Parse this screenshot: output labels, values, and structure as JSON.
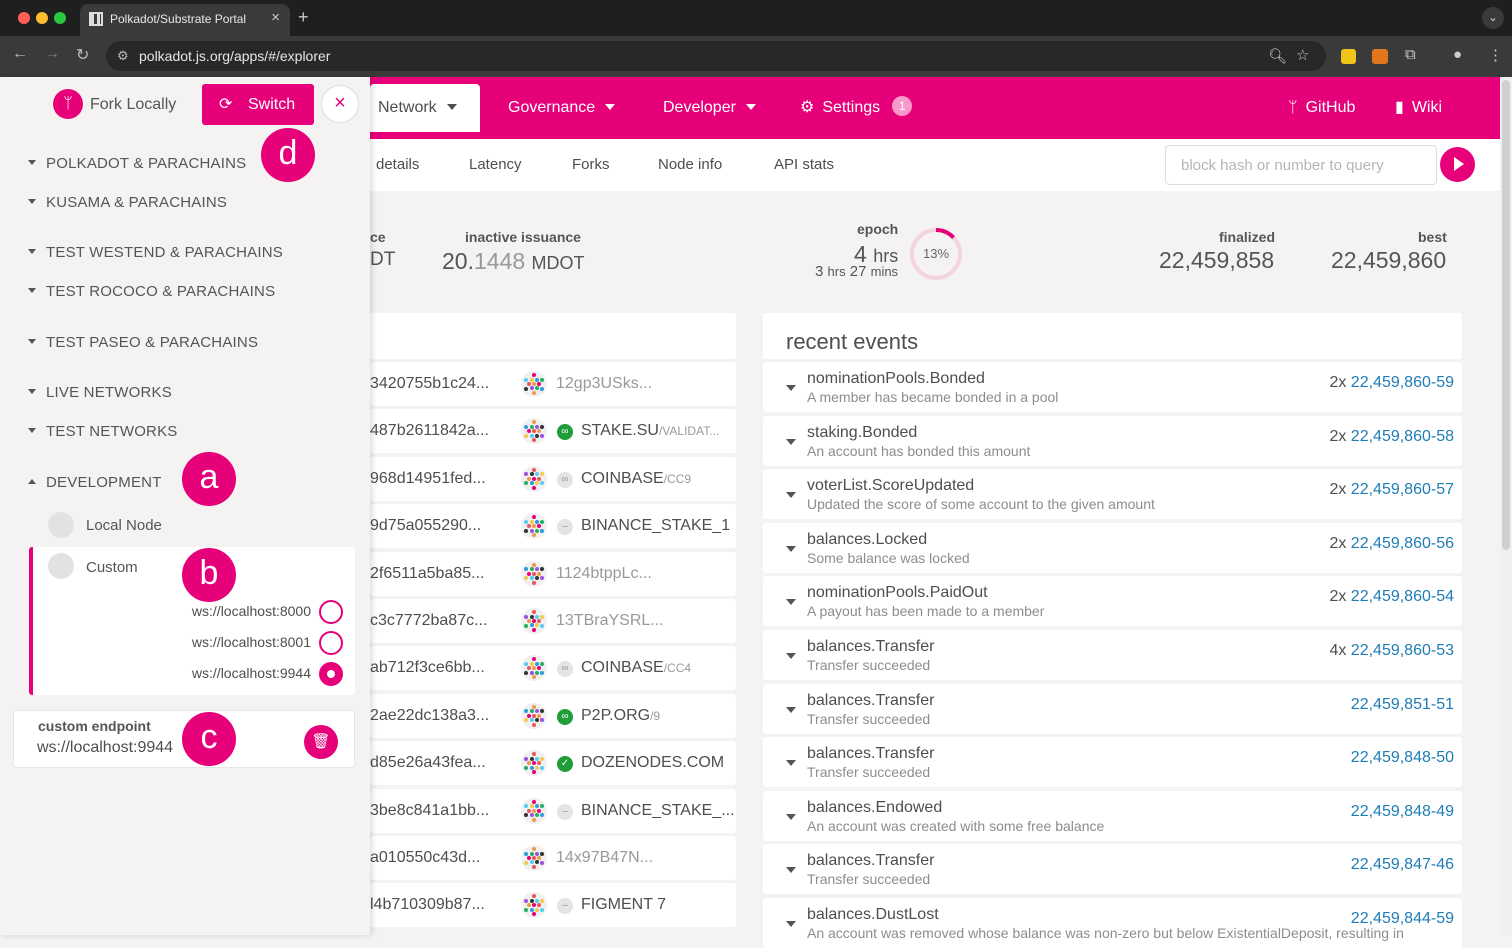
{
  "browser": {
    "tab_title": "Polkadot/Substrate Portal",
    "url": "polkadot.js.org/apps/#/explorer"
  },
  "colors": {
    "accent": "#e6007a",
    "link": "#1e7db5"
  },
  "topnav": {
    "network": "Network",
    "governance": "Governance",
    "developer": "Developer",
    "settings": "Settings",
    "settings_badge": "1",
    "github": "GitHub",
    "wiki": "Wiki"
  },
  "subnav": {
    "tabs": [
      "details",
      "Latency",
      "Forks",
      "Node info",
      "API stats"
    ],
    "search_placeholder": "block hash or number to query"
  },
  "stats": {
    "partial_label": "ce",
    "partial_value": "DT",
    "inactive_label": "inactive issuance",
    "inactive_int": "20.",
    "inactive_frac": "1448",
    "inactive_unit": "MDOT",
    "epoch_label": "epoch",
    "epoch_hrs": "4",
    "epoch_hrs_unit": "hrs",
    "epoch_sub_h": "3",
    "epoch_sub_h_unit": "hrs",
    "epoch_sub_m": "27",
    "epoch_sub_m_unit": "mins",
    "epoch_percent_text": "13%",
    "epoch_progress": 0.13,
    "finalized_label": "finalized",
    "finalized": "22,459,858",
    "best_label": "best",
    "best": "22,459,860"
  },
  "blocks": [
    {
      "hash": "3420755b1c24...",
      "author": "12gp3USks...",
      "icon": "none",
      "sub": ""
    },
    {
      "hash": "487b2611842a...",
      "author": "STAKE.SU",
      "icon": "link",
      "sub": "/VALIDAT..."
    },
    {
      "hash": "968d14951fed...",
      "author": "COINBASE",
      "icon": "link-gray",
      "sub": "/CC9"
    },
    {
      "hash": "9d75a055290...",
      "author": "BINANCE_STAKE_1",
      "icon": "minus",
      "sub": ""
    },
    {
      "hash": "2f6511a5ba85...",
      "author": "1124btppLc...",
      "icon": "none",
      "sub": ""
    },
    {
      "hash": "c3c7772ba87c...",
      "author": "13TBraYSRL...",
      "icon": "none",
      "sub": ""
    },
    {
      "hash": "ab712f3ce6bb...",
      "author": "COINBASE",
      "icon": "link-gray",
      "sub": "/CC4"
    },
    {
      "hash": "2ae22dc138a3...",
      "author": "P2P.ORG",
      "icon": "link",
      "sub": "/9"
    },
    {
      "hash": "d85e26a43fea...",
      "author": "DOZENODES.COM",
      "icon": "check",
      "sub": ""
    },
    {
      "hash": "3be8c841a1bb...",
      "author": "BINANCE_STAKE_...",
      "icon": "minus",
      "sub": ""
    },
    {
      "hash": "a010550c43d...",
      "author": "14x97B47N...",
      "icon": "none",
      "sub": ""
    },
    {
      "hash": "l4b710309b87...",
      "author": "FIGMENT 7",
      "icon": "minus",
      "sub": ""
    }
  ],
  "events": {
    "title": "recent events",
    "items": [
      {
        "name": "nominationPools.Bonded",
        "desc": "A member has became bonded in a pool",
        "count": "2x",
        "block": "22,459,860-59"
      },
      {
        "name": "staking.Bonded",
        "desc": "An account has bonded this amount",
        "count": "2x",
        "block": "22,459,860-58"
      },
      {
        "name": "voterList.ScoreUpdated",
        "desc": "Updated the score of some account to the given amount",
        "count": "2x",
        "block": "22,459,860-57"
      },
      {
        "name": "balances.Locked",
        "desc": "Some balance was locked",
        "count": "2x",
        "block": "22,459,860-56"
      },
      {
        "name": "nominationPools.PaidOut",
        "desc": "A payout has been made to a member",
        "count": "2x",
        "block": "22,459,860-54"
      },
      {
        "name": "balances.Transfer",
        "desc": "Transfer succeeded",
        "count": "4x",
        "block": "22,459,860-53"
      },
      {
        "name": "balances.Transfer",
        "desc": "Transfer succeeded",
        "count": "",
        "block": "22,459,851-51"
      },
      {
        "name": "balances.Transfer",
        "desc": "Transfer succeeded",
        "count": "",
        "block": "22,459,848-50"
      },
      {
        "name": "balances.Endowed",
        "desc": "An account was created with some free balance",
        "count": "",
        "block": "22,459,848-49"
      },
      {
        "name": "balances.Transfer",
        "desc": "Transfer succeeded",
        "count": "",
        "block": "22,459,847-46"
      },
      {
        "name": "balances.DustLost",
        "desc": "An account was removed whose balance was non-zero but below ExistentialDeposit, resulting in",
        "count": "",
        "block": "22,459,844-59"
      }
    ]
  },
  "sidebar": {
    "fork_locally": "Fork Locally",
    "switch": "Switch",
    "close": "×",
    "groups": [
      "POLKADOT & PARACHAINS",
      "KUSAMA & PARACHAINS",
      "TEST WESTEND & PARACHAINS",
      "TEST ROCOCO & PARACHAINS",
      "TEST PASEO & PARACHAINS",
      "LIVE NETWORKS",
      "TEST NETWORKS",
      "DEVELOPMENT"
    ],
    "local_node": "Local Node",
    "custom": "Custom",
    "endpoints": [
      "ws://localhost:8000",
      "ws://localhost:8001",
      "ws://localhost:9944"
    ],
    "selected_endpoint_index": 2,
    "custom_endpoint_label": "custom endpoint",
    "custom_endpoint_value": "ws://localhost:9944"
  },
  "callouts": {
    "a": "a",
    "b": "b",
    "c": "c",
    "d": "d"
  }
}
